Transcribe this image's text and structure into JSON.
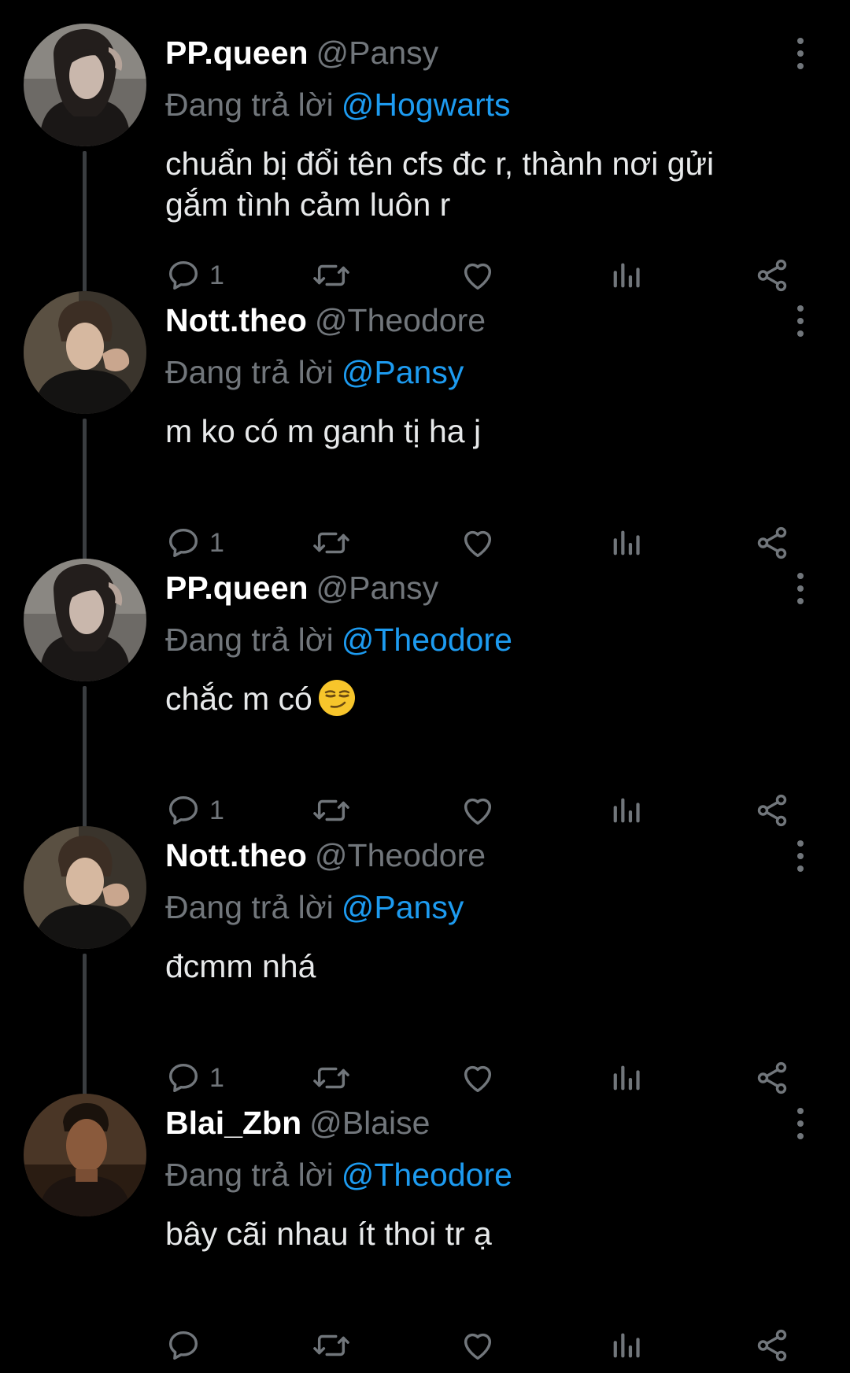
{
  "reply_prefix": "Đang trả lời",
  "tweets": [
    {
      "display_name": "PP.queen",
      "handle": "@Pansy",
      "reply_to": "@Hogwarts",
      "text": "chuẩn bị đổi tên cfs đc r, thành nơi gửi gắm tình cảm luôn r",
      "reply_count": "1",
      "avatar": "pansy-avatar"
    },
    {
      "display_name": "Nott.theo",
      "handle": "@Theodore",
      "reply_to": "@Pansy",
      "text": "m ko có m ganh tị ha j",
      "reply_count": "1",
      "avatar": "theodore-avatar"
    },
    {
      "display_name": "PP.queen",
      "handle": "@Pansy",
      "reply_to": "@Theodore",
      "text": "chắc m có",
      "emoji": "smirking-face-emoji",
      "reply_count": "1",
      "avatar": "pansy-avatar"
    },
    {
      "display_name": "Nott.theo",
      "handle": "@Theodore",
      "reply_to": "@Pansy",
      "text": "đcmm nhá",
      "reply_count": "1",
      "avatar": "theodore-avatar"
    },
    {
      "display_name": "Blai_Zbn",
      "handle": "@Blaise",
      "reply_to": "@Theodore",
      "text": "bây cãi nhau ít thoi tr ạ",
      "reply_count": "",
      "avatar": "blaise-avatar"
    }
  ],
  "colors": {
    "background": "#000000",
    "text": "#e7e9ea",
    "muted": "#71767b",
    "accent": "#1d9bf0",
    "thread_line": "#3a3d40"
  },
  "icons": [
    "reply-icon",
    "retweet-icon",
    "like-icon",
    "views-icon",
    "share-icon",
    "more-icon"
  ]
}
